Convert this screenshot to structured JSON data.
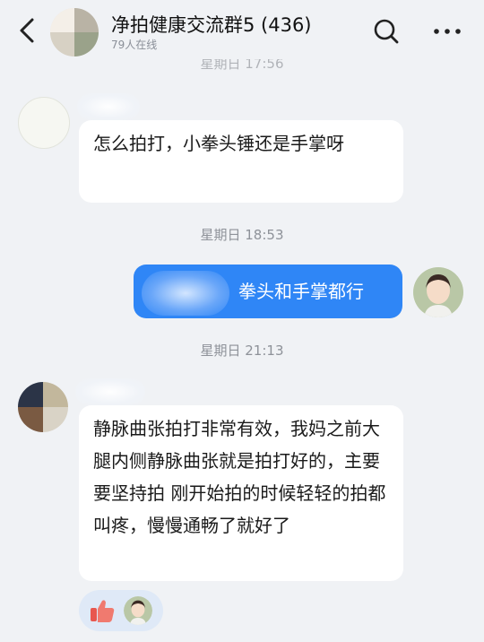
{
  "header": {
    "title": "净拍健康交流群5 (436)",
    "online": "79人在线"
  },
  "messages": [
    {
      "timestamp": "星期日 17:56"
    },
    {
      "text": "怎么拍打，小拳头锤还是手掌呀"
    },
    {
      "timestamp": "星期日 18:53"
    },
    {
      "text": "拳头和手掌都行"
    },
    {
      "timestamp": "星期日 21:13"
    },
    {
      "text": "静脉曲张拍打非常有效，我妈之前大腿内侧静脉曲张就是拍打好的，主要要坚持拍 刚开始拍的时候轻轻的拍都叫疼，慢慢通畅了就好了"
    }
  ],
  "colors": {
    "accent": "#2f86f6",
    "background": "#f0f2f5",
    "bubble_in": "#ffffff"
  },
  "icons": {
    "back": "chevron-left-icon",
    "search": "search-icon",
    "more": "more-dots-icon",
    "reaction": "thumbs-up-icon"
  }
}
